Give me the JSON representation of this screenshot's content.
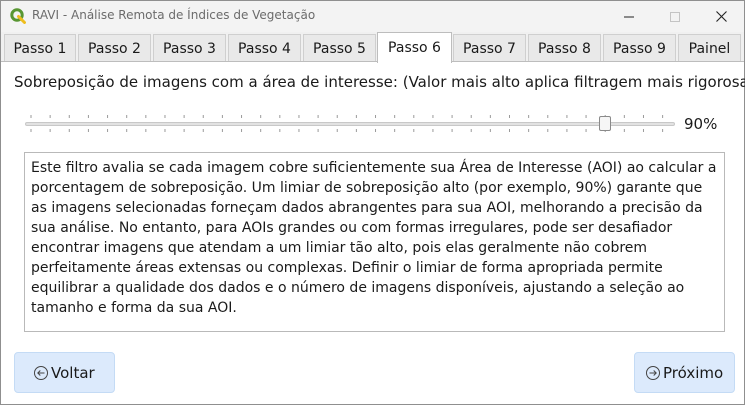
{
  "window": {
    "title": "RAVI - Análise Remota de Índices de Vegetação",
    "icon": "qgis-icon"
  },
  "tabs": [
    {
      "label": "Passo 1"
    },
    {
      "label": "Passo 2"
    },
    {
      "label": "Passo 3"
    },
    {
      "label": "Passo 4"
    },
    {
      "label": "Passo 5"
    },
    {
      "label": "Passo 6",
      "active": true
    },
    {
      "label": "Passo 7"
    },
    {
      "label": "Passo 8"
    },
    {
      "label": "Passo 9"
    },
    {
      "label": "Painel"
    }
  ],
  "step": {
    "heading": "Sobreposição de imagens com a área de interesse: (Valor mais alto aplica filtragem mais rigorosa)",
    "slider": {
      "value": 90,
      "min": 0,
      "max": 100,
      "value_label": "90%"
    },
    "description": "Este filtro avalia se cada imagem cobre suficientemente sua Área de Interesse (AOI) ao calcular a porcentagem de sobreposição. Um limiar de sobreposição alto (por exemplo, 90%) garante que as imagens selecionadas forneçam dados abrangentes para sua AOI, melhorando a precisão da sua análise. No entanto, para AOIs grandes ou com formas irregulares, pode ser desafiador encontrar imagens que atendam a um limiar tão alto, pois elas geralmente não cobrem perfeitamente áreas extensas ou complexas. Definir o limiar de forma apropriada permite equilibrar a qualidade dos dados e o número de imagens disponíveis, ajustando a seleção ao tamanho e forma da sua AOI."
  },
  "buttons": {
    "back": "Voltar",
    "next": "Próximo"
  },
  "colors": {
    "accent_button": "#dceafc",
    "qgis_green": "#589632",
    "qgis_yellow": "#eebd1d"
  }
}
